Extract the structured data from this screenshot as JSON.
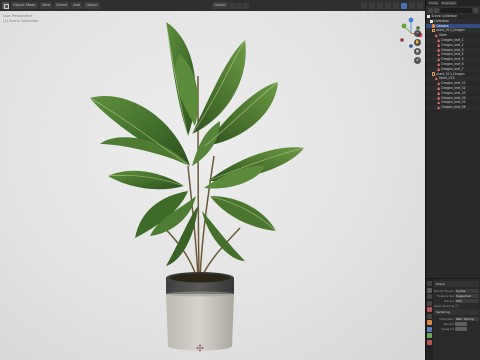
{
  "viewport": {
    "menu": [
      "View",
      "Select",
      "Add",
      "Object"
    ],
    "mode_label": "Object Mode",
    "shading_label": "Global",
    "info_lines": [
      "User Perspective",
      "(1) Scene Collection"
    ],
    "gizmo": {
      "x_label": "X",
      "y_label": "Y",
      "z_label": "Z"
    },
    "nav_tools": [
      "zoom",
      "hand",
      "camera",
      "grid"
    ]
  },
  "topbar": {
    "items": [
      "Scene",
      "ViewLayer"
    ]
  },
  "outliner": {
    "rows": [
      {
        "label": "Scene Collection",
        "icon": "collection",
        "indent": 0,
        "selected": false
      },
      {
        "label": "Collection",
        "icon": "collection",
        "indent": 1,
        "selected": false
      },
      {
        "label": "Camera",
        "icon": "object",
        "indent": 2,
        "selected": true
      },
      {
        "label": "plant_013_Dragon",
        "icon": "empty",
        "indent": 2,
        "selected": false
      },
      {
        "label": "Stem",
        "icon": "mesh",
        "indent": 3,
        "selected": false
      },
      {
        "label": "Dragon_leaf_1",
        "icon": "mesh",
        "indent": 4,
        "selected": false
      },
      {
        "label": "Dragon_leaf_2",
        "icon": "mesh",
        "indent": 4,
        "selected": false
      },
      {
        "label": "Dragon_leaf_3",
        "icon": "mesh",
        "indent": 4,
        "selected": false
      },
      {
        "label": "Dragon_leaf_4",
        "icon": "mesh",
        "indent": 4,
        "selected": false
      },
      {
        "label": "Dragon_leaf_5",
        "icon": "mesh",
        "indent": 4,
        "selected": false
      },
      {
        "label": "Dragon_leaf_6",
        "icon": "mesh",
        "indent": 4,
        "selected": false
      },
      {
        "label": "Dragon_leaf_7",
        "icon": "mesh",
        "indent": 4,
        "selected": false
      },
      {
        "label": "plant_013_Dragon",
        "icon": "empty",
        "indent": 2,
        "selected": false
      },
      {
        "label": "Stem_013",
        "icon": "mesh",
        "indent": 3,
        "selected": false
      },
      {
        "label": "Dragon_leaf_01",
        "icon": "mesh",
        "indent": 4,
        "selected": false
      },
      {
        "label": "Dragon_leaf_02",
        "icon": "mesh",
        "indent": 4,
        "selected": false
      },
      {
        "label": "Dragon_leaf_03",
        "icon": "mesh",
        "indent": 4,
        "selected": false
      },
      {
        "label": "Dragon_leaf_04",
        "icon": "mesh",
        "indent": 4,
        "selected": false
      },
      {
        "label": "Dragon_leaf_05",
        "icon": "mesh",
        "indent": 4,
        "selected": false
      },
      {
        "label": "Dragon_leaf_06",
        "icon": "mesh",
        "indent": 4,
        "selected": false
      }
    ]
  },
  "properties": {
    "section_scene": "Scene",
    "render_engine_label": "Render Engine",
    "render_engine_value": "Cycles",
    "feature_set_label": "Feature Set",
    "feature_set_value": "Supported",
    "device_label": "Device",
    "device_value": "CPU",
    "osl_label": "Open Shading Language",
    "section_sampling": "Sampling",
    "integrator_label": "Integrator",
    "integrator_value": "Path Tracing",
    "render_label": "Render",
    "viewport_label": "Viewport"
  },
  "colors": {
    "accent_blue": "#4772b3",
    "selection": "#334d80",
    "axis_x": "#e0464a",
    "axis_y": "#6ba33b",
    "axis_z": "#3f7fd8"
  }
}
